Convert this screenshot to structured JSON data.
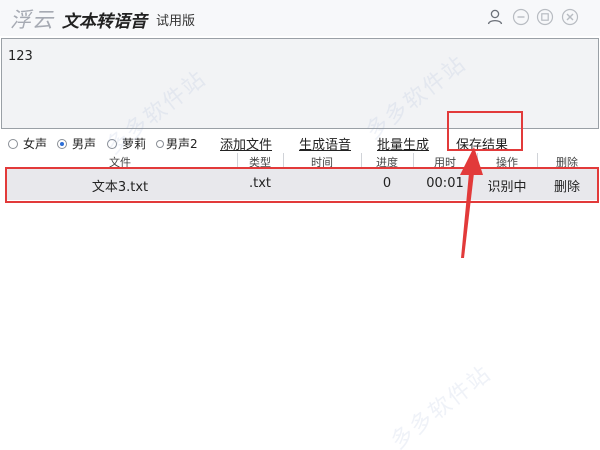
{
  "titlebar": {
    "logo": "浮云",
    "app_name": "文本转语音",
    "edition": "试用版",
    "icons": [
      "user-icon",
      "minimize-icon",
      "maximize-icon",
      "close-icon"
    ]
  },
  "text_panel": {
    "value": "123"
  },
  "voices": [
    {
      "label": "女声",
      "checked": false
    },
    {
      "label": "男声",
      "checked": true
    },
    {
      "label": "萝莉",
      "checked": false
    },
    {
      "label": "男声2",
      "checked": false
    }
  ],
  "actions": {
    "add_file": "添加文件",
    "generate": "生成语音",
    "batch": "批量生成",
    "save": "保存结果"
  },
  "table": {
    "columns": [
      "文件",
      "类型",
      "时间",
      "进度",
      "用时",
      "操作",
      "删除"
    ],
    "rows": [
      {
        "file": "文本3.txt",
        "type": ".txt",
        "time": "",
        "progress": "0",
        "elapsed": "00:01",
        "status": "识别中",
        "delete": "删除"
      }
    ]
  },
  "watermark": "多多软件站",
  "colors": {
    "highlight": "#e23a3a",
    "radio_checked": "#2c6ed6"
  }
}
